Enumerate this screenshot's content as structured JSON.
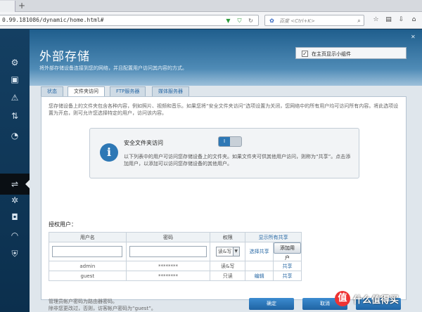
{
  "browser": {
    "new_tab_glyph": "+",
    "url": "0.99.181086/dynamic/home.html#",
    "search_placeholder": "百度 <Ctrl+K>"
  },
  "sidebar": {
    "icons": [
      "network-map-icon",
      "router-icon",
      "alert-icon",
      "speed-icon",
      "time-icon",
      "usb-storage-icon",
      "settings-icon",
      "security-camera-icon",
      "wireless-icon",
      "shield-icon"
    ]
  },
  "header": {
    "title": "外部存储",
    "description": "将外部存储设备连接到您的网络，并且配置用户访问其内容的方式。",
    "close_glyph": "✕",
    "widget_checkbox_label": "在主页显示小组件",
    "widget_checked": true
  },
  "tabs": [
    {
      "label": "状态"
    },
    {
      "label": "文件夹访问"
    },
    {
      "label": "FTP服务器"
    },
    {
      "label": "媒体服务器"
    }
  ],
  "intro": "您存储设备上的文件夹包含各种内容，例如照片、视频和音乐。如果您将“安全文件夹访问”选项设置为关闭，您网络中的所有用户均可访问所有内容。将此选项设置为开启，则可允许您选择特定的用户，访问该内容。",
  "secure_access": {
    "icon": "i",
    "title": "安全文件夹访问",
    "toggle_label": "I",
    "body": "以下列表中的用户可访问您存储设备上的文件夹。如果文件夹可供其他用户访问，则称为“共享”。点击添加用户，以添加可以访问您存储设备的其他用户。"
  },
  "users_section": {
    "title": "授权用户：",
    "headers": [
      "用户名",
      "密码",
      "权限",
      "显示所有共享"
    ],
    "input_row": {
      "permission": "读&写",
      "select_share": "选择共享",
      "add_user": "添加用户"
    },
    "rows": [
      {
        "username": "admin",
        "password": "********",
        "permission": "读&写",
        "action1": "",
        "action2": "共享"
      },
      {
        "username": "guest",
        "password": "********",
        "permission": "只读",
        "action1": "编辑",
        "action2": "共享"
      }
    ]
  },
  "footnote": [
    "管理员帐户密码为路由器密码。",
    "除非您更改过，否则，访客帐户密码为“guest”。"
  ],
  "buttons": {
    "ok": "确定",
    "cancel": "取消"
  },
  "watermark": {
    "badge": "值",
    "text": "什么值得买"
  }
}
